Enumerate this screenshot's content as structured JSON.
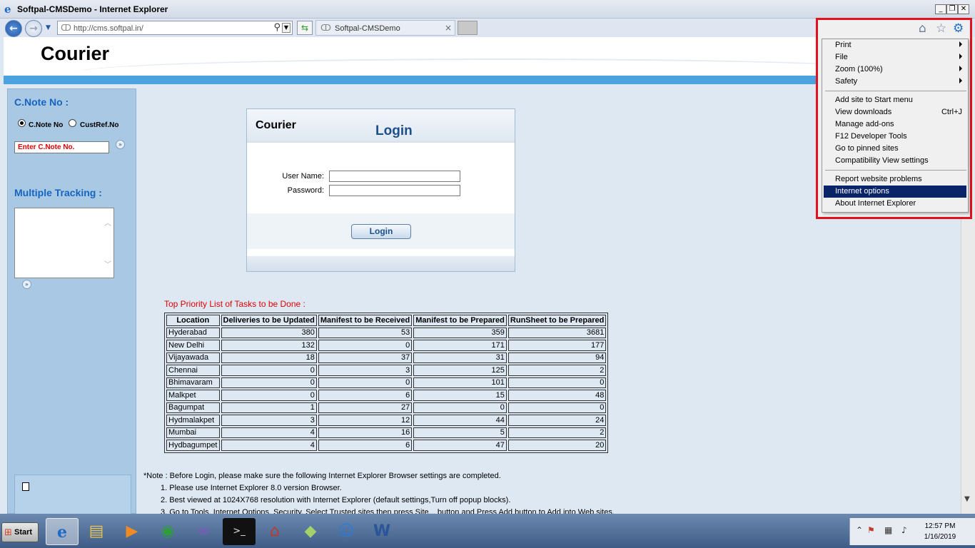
{
  "window": {
    "title": "Softpal-CMSDemo - Internet Explorer",
    "min_glyph": "_",
    "restore_glyph": "❐",
    "close_glyph": "✕"
  },
  "browser": {
    "url": "http://cms.softpal.in/",
    "tab_title": "Softpal-CMSDemo",
    "tab_close": "×"
  },
  "header": {
    "brand": "Courier"
  },
  "sidebar": {
    "cnote_heading": "C.Note No :",
    "radio_cnote": "C.Note No",
    "radio_custref": "CustRef.No",
    "cnote_placeholder": "Enter C.Note No.",
    "multiple_heading": "Multiple Tracking :"
  },
  "login": {
    "brand": "Courier",
    "title": "Login",
    "username_label": "User Name:",
    "password_label": "Password:",
    "button": "Login"
  },
  "tasks": {
    "title": "Top Priority List of Tasks to be Done :",
    "columns": [
      "Location",
      "Deliveries to be Updated",
      "Manifest to be Received",
      "Manifest to be Prepared",
      "RunSheet to be Prepared"
    ],
    "rows": [
      [
        "Hyderabad",
        "380",
        "53",
        "359",
        "3681"
      ],
      [
        "New Delhi",
        "132",
        "0",
        "171",
        "177"
      ],
      [
        "Vijayawada",
        "18",
        "37",
        "31",
        "94"
      ],
      [
        "Chennai",
        "0",
        "3",
        "125",
        "2"
      ],
      [
        "Bhimavaram",
        "0",
        "0",
        "101",
        "0"
      ],
      [
        "Malkpet",
        "0",
        "6",
        "15",
        "48"
      ],
      [
        "Bagumpat",
        "1",
        "27",
        "0",
        "0"
      ],
      [
        "Hydmalakpet",
        "3",
        "12",
        "44",
        "24"
      ],
      [
        "Mumbai",
        "4",
        "16",
        "5",
        "2"
      ],
      [
        "Hydbagumpet",
        "4",
        "6",
        "47",
        "20"
      ]
    ]
  },
  "notes": {
    "intro": "*Note : Before Login, please make sure the following Internet Explorer Browser settings are completed.",
    "items": [
      "1. Please use Internet Explorer 8.0 version Browser.",
      "2. Best viewed at 1024X768 resolution with Internet Explorer (default settings,Turn off popup blocks).",
      "3. Go to Tools. Internet Options. Security. Select Trusted sites then press Site... button and Press Add button to Add into Web sites."
    ]
  },
  "tools_menu": {
    "items": [
      {
        "label": "Print",
        "submenu": true
      },
      {
        "label": "File",
        "submenu": true
      },
      {
        "label": "Zoom (100%)",
        "submenu": true
      },
      {
        "label": "Safety",
        "submenu": true
      },
      {
        "label": "Add site to Start menu"
      },
      {
        "label": "View downloads",
        "shortcut": "Ctrl+J"
      },
      {
        "label": "Manage add-ons"
      },
      {
        "label": "F12 Developer Tools"
      },
      {
        "label": "Go to pinned sites"
      },
      {
        "label": "Compatibility View settings"
      },
      {
        "label": "Report website problems"
      },
      {
        "label": "Internet options",
        "highlighted": true
      },
      {
        "label": "About Internet Explorer"
      }
    ]
  },
  "taskbar": {
    "start": "Start",
    "time": "12:57 PM",
    "date": "1/16/2019"
  },
  "colors": {
    "highlight_frame": "#e3101e",
    "menu_highlight": "#0a246a",
    "sidebar_heading": "#1565c0",
    "alert_text": "#e00000"
  }
}
